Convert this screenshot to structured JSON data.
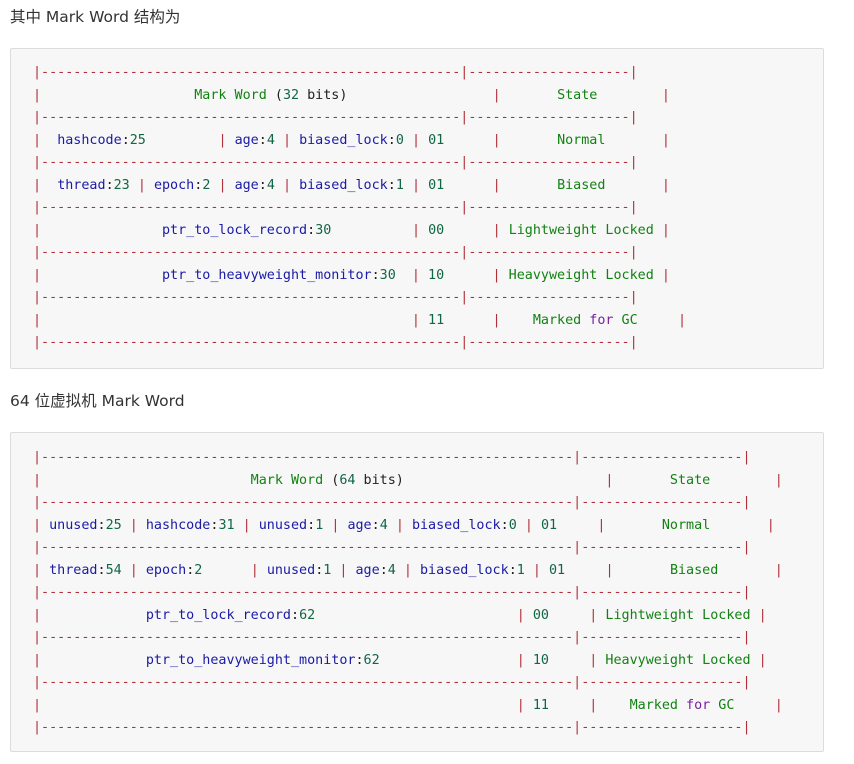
{
  "heading32": "其中 Mark Word 结构为",
  "heading64": "64 位虚拟机 Mark Word",
  "table32": [
    [
      [
        "rule",
        "|----------------------------------------------------|--------------------|"
      ]
    ],
    [
      [
        "rule",
        "|"
      ],
      [
        "plain",
        "                   "
      ],
      [
        "state",
        "Mark Word"
      ],
      [
        "plain",
        " ("
      ],
      [
        "num",
        "32"
      ],
      [
        "plain",
        " bits)"
      ],
      [
        "plain",
        "                  "
      ],
      [
        "rule",
        "|"
      ],
      [
        "plain",
        "       "
      ],
      [
        "state",
        "State"
      ],
      [
        "plain",
        "        "
      ],
      [
        "rule",
        "|"
      ]
    ],
    [
      [
        "rule",
        "|----------------------------------------------------|--------------------|"
      ]
    ],
    [
      [
        "rule",
        "|"
      ],
      [
        "plain",
        "  "
      ],
      [
        "text",
        "hashcode"
      ],
      [
        "plain",
        ":"
      ],
      [
        "num",
        "25"
      ],
      [
        "plain",
        "         "
      ],
      [
        "rule",
        "|"
      ],
      [
        "plain",
        " "
      ],
      [
        "text",
        "age"
      ],
      [
        "plain",
        ":"
      ],
      [
        "num",
        "4"
      ],
      [
        "plain",
        " "
      ],
      [
        "rule",
        "|"
      ],
      [
        "plain",
        " "
      ],
      [
        "text",
        "biased_lock"
      ],
      [
        "plain",
        ":"
      ],
      [
        "num",
        "0"
      ],
      [
        "plain",
        " "
      ],
      [
        "rule",
        "|"
      ],
      [
        "plain",
        " "
      ],
      [
        "num",
        "01"
      ],
      [
        "plain",
        "      "
      ],
      [
        "rule",
        "|"
      ],
      [
        "plain",
        "       "
      ],
      [
        "state",
        "Normal"
      ],
      [
        "plain",
        "       "
      ],
      [
        "rule",
        "|"
      ]
    ],
    [
      [
        "rule",
        "|----------------------------------------------------|--------------------|"
      ]
    ],
    [
      [
        "rule",
        "|"
      ],
      [
        "plain",
        "  "
      ],
      [
        "text",
        "thread"
      ],
      [
        "plain",
        ":"
      ],
      [
        "num",
        "23"
      ],
      [
        "plain",
        " "
      ],
      [
        "rule",
        "|"
      ],
      [
        "plain",
        " "
      ],
      [
        "text",
        "epoch"
      ],
      [
        "plain",
        ":"
      ],
      [
        "num",
        "2"
      ],
      [
        "plain",
        " "
      ],
      [
        "rule",
        "|"
      ],
      [
        "plain",
        " "
      ],
      [
        "text",
        "age"
      ],
      [
        "plain",
        ":"
      ],
      [
        "num",
        "4"
      ],
      [
        "plain",
        " "
      ],
      [
        "rule",
        "|"
      ],
      [
        "plain",
        " "
      ],
      [
        "text",
        "biased_lock"
      ],
      [
        "plain",
        ":"
      ],
      [
        "num",
        "1"
      ],
      [
        "plain",
        " "
      ],
      [
        "rule",
        "|"
      ],
      [
        "plain",
        " "
      ],
      [
        "num",
        "01"
      ],
      [
        "plain",
        "      "
      ],
      [
        "rule",
        "|"
      ],
      [
        "plain",
        "       "
      ],
      [
        "state",
        "Biased"
      ],
      [
        "plain",
        "       "
      ],
      [
        "rule",
        "|"
      ]
    ],
    [
      [
        "rule",
        "|----------------------------------------------------|--------------------|"
      ]
    ],
    [
      [
        "rule",
        "|"
      ],
      [
        "plain",
        "               "
      ],
      [
        "text",
        "ptr_to_lock_record"
      ],
      [
        "plain",
        ":"
      ],
      [
        "num",
        "30"
      ],
      [
        "plain",
        "          "
      ],
      [
        "rule",
        "|"
      ],
      [
        "plain",
        " "
      ],
      [
        "num",
        "00"
      ],
      [
        "plain",
        "      "
      ],
      [
        "rule",
        "|"
      ],
      [
        "plain",
        " "
      ],
      [
        "state",
        "Lightweight Locked"
      ],
      [
        "plain",
        " "
      ],
      [
        "rule",
        "|"
      ]
    ],
    [
      [
        "rule",
        "|----------------------------------------------------|--------------------|"
      ]
    ],
    [
      [
        "rule",
        "|"
      ],
      [
        "plain",
        "               "
      ],
      [
        "text",
        "ptr_to_heavyweight_monitor"
      ],
      [
        "plain",
        ":"
      ],
      [
        "num",
        "30"
      ],
      [
        "plain",
        "  "
      ],
      [
        "rule",
        "|"
      ],
      [
        "plain",
        " "
      ],
      [
        "num",
        "10"
      ],
      [
        "plain",
        "      "
      ],
      [
        "rule",
        "|"
      ],
      [
        "plain",
        " "
      ],
      [
        "state",
        "Heavyweight Locked"
      ],
      [
        "plain",
        " "
      ],
      [
        "rule",
        "|"
      ]
    ],
    [
      [
        "rule",
        "|----------------------------------------------------|--------------------|"
      ]
    ],
    [
      [
        "rule",
        "|"
      ],
      [
        "plain",
        "                                              "
      ],
      [
        "rule",
        "|"
      ],
      [
        "plain",
        " "
      ],
      [
        "num",
        "11"
      ],
      [
        "plain",
        "      "
      ],
      [
        "rule",
        "|"
      ],
      [
        "plain",
        "    "
      ],
      [
        "state",
        "Marked"
      ],
      [
        "plain",
        " "
      ],
      [
        "kw",
        "for"
      ],
      [
        "plain",
        " "
      ],
      [
        "state",
        "GC"
      ],
      [
        "plain",
        "     "
      ],
      [
        "rule",
        "|"
      ]
    ],
    [
      [
        "rule",
        "|----------------------------------------------------|--------------------|"
      ]
    ]
  ],
  "table64": [
    [
      [
        "rule",
        "|------------------------------------------------------------------|--------------------|"
      ]
    ],
    [
      [
        "rule",
        "|"
      ],
      [
        "plain",
        "                          "
      ],
      [
        "state",
        "Mark Word"
      ],
      [
        "plain",
        " ("
      ],
      [
        "num",
        "64"
      ],
      [
        "plain",
        " bits)"
      ],
      [
        "plain",
        "                         "
      ],
      [
        "rule",
        "|"
      ],
      [
        "plain",
        "       "
      ],
      [
        "state",
        "State"
      ],
      [
        "plain",
        "        "
      ],
      [
        "rule",
        "|"
      ]
    ],
    [
      [
        "rule",
        "|------------------------------------------------------------------|--------------------|"
      ]
    ],
    [
      [
        "rule",
        "|"
      ],
      [
        "plain",
        " "
      ],
      [
        "text",
        "unused"
      ],
      [
        "plain",
        ":"
      ],
      [
        "num",
        "25"
      ],
      [
        "plain",
        " "
      ],
      [
        "rule",
        "|"
      ],
      [
        "plain",
        " "
      ],
      [
        "text",
        "hashcode"
      ],
      [
        "plain",
        ":"
      ],
      [
        "num",
        "31"
      ],
      [
        "plain",
        " "
      ],
      [
        "rule",
        "|"
      ],
      [
        "plain",
        " "
      ],
      [
        "text",
        "unused"
      ],
      [
        "plain",
        ":"
      ],
      [
        "num",
        "1"
      ],
      [
        "plain",
        " "
      ],
      [
        "rule",
        "|"
      ],
      [
        "plain",
        " "
      ],
      [
        "text",
        "age"
      ],
      [
        "plain",
        ":"
      ],
      [
        "num",
        "4"
      ],
      [
        "plain",
        " "
      ],
      [
        "rule",
        "|"
      ],
      [
        "plain",
        " "
      ],
      [
        "text",
        "biased_lock"
      ],
      [
        "plain",
        ":"
      ],
      [
        "num",
        "0"
      ],
      [
        "plain",
        " "
      ],
      [
        "rule",
        "|"
      ],
      [
        "plain",
        " "
      ],
      [
        "num",
        "01"
      ],
      [
        "plain",
        "     "
      ],
      [
        "rule",
        "|"
      ],
      [
        "plain",
        "       "
      ],
      [
        "state",
        "Normal"
      ],
      [
        "plain",
        "       "
      ],
      [
        "rule",
        "|"
      ]
    ],
    [
      [
        "rule",
        "|------------------------------------------------------------------|--------------------|"
      ]
    ],
    [
      [
        "rule",
        "|"
      ],
      [
        "plain",
        " "
      ],
      [
        "text",
        "thread"
      ],
      [
        "plain",
        ":"
      ],
      [
        "num",
        "54"
      ],
      [
        "plain",
        " "
      ],
      [
        "rule",
        "|"
      ],
      [
        "plain",
        " "
      ],
      [
        "text",
        "epoch"
      ],
      [
        "plain",
        ":"
      ],
      [
        "num",
        "2"
      ],
      [
        "plain",
        "      "
      ],
      [
        "rule",
        "|"
      ],
      [
        "plain",
        " "
      ],
      [
        "text",
        "unused"
      ],
      [
        "plain",
        ":"
      ],
      [
        "num",
        "1"
      ],
      [
        "plain",
        " "
      ],
      [
        "rule",
        "|"
      ],
      [
        "plain",
        " "
      ],
      [
        "text",
        "age"
      ],
      [
        "plain",
        ":"
      ],
      [
        "num",
        "4"
      ],
      [
        "plain",
        " "
      ],
      [
        "rule",
        "|"
      ],
      [
        "plain",
        " "
      ],
      [
        "text",
        "biased_lock"
      ],
      [
        "plain",
        ":"
      ],
      [
        "num",
        "1"
      ],
      [
        "plain",
        " "
      ],
      [
        "rule",
        "|"
      ],
      [
        "plain",
        " "
      ],
      [
        "num",
        "01"
      ],
      [
        "plain",
        "     "
      ],
      [
        "rule",
        "|"
      ],
      [
        "plain",
        "       "
      ],
      [
        "state",
        "Biased"
      ],
      [
        "plain",
        "       "
      ],
      [
        "rule",
        "|"
      ]
    ],
    [
      [
        "rule",
        "|------------------------------------------------------------------|--------------------|"
      ]
    ],
    [
      [
        "rule",
        "|"
      ],
      [
        "plain",
        "             "
      ],
      [
        "text",
        "ptr_to_lock_record"
      ],
      [
        "plain",
        ":"
      ],
      [
        "num",
        "62"
      ],
      [
        "plain",
        "                         "
      ],
      [
        "rule",
        "|"
      ],
      [
        "plain",
        " "
      ],
      [
        "num",
        "00"
      ],
      [
        "plain",
        "     "
      ],
      [
        "rule",
        "|"
      ],
      [
        "plain",
        " "
      ],
      [
        "state",
        "Lightweight Locked"
      ],
      [
        "plain",
        " "
      ],
      [
        "rule",
        "|"
      ]
    ],
    [
      [
        "rule",
        "|------------------------------------------------------------------|--------------------|"
      ]
    ],
    [
      [
        "rule",
        "|"
      ],
      [
        "plain",
        "             "
      ],
      [
        "text",
        "ptr_to_heavyweight_monitor"
      ],
      [
        "plain",
        ":"
      ],
      [
        "num",
        "62"
      ],
      [
        "plain",
        "                 "
      ],
      [
        "rule",
        "|"
      ],
      [
        "plain",
        " "
      ],
      [
        "num",
        "10"
      ],
      [
        "plain",
        "     "
      ],
      [
        "rule",
        "|"
      ],
      [
        "plain",
        " "
      ],
      [
        "state",
        "Heavyweight Locked"
      ],
      [
        "plain",
        " "
      ],
      [
        "rule",
        "|"
      ]
    ],
    [
      [
        "rule",
        "|------------------------------------------------------------------|--------------------|"
      ]
    ],
    [
      [
        "rule",
        "|"
      ],
      [
        "plain",
        "                                                           "
      ],
      [
        "rule",
        "|"
      ],
      [
        "plain",
        " "
      ],
      [
        "num",
        "11"
      ],
      [
        "plain",
        "     "
      ],
      [
        "rule",
        "|"
      ],
      [
        "plain",
        "    "
      ],
      [
        "state",
        "Marked"
      ],
      [
        "plain",
        " "
      ],
      [
        "kw",
        "for"
      ],
      [
        "plain",
        " "
      ],
      [
        "state",
        "GC"
      ],
      [
        "plain",
        "     "
      ],
      [
        "rule",
        "|"
      ]
    ],
    [
      [
        "rule",
        "|------------------------------------------------------------------|--------------------|"
      ]
    ]
  ]
}
